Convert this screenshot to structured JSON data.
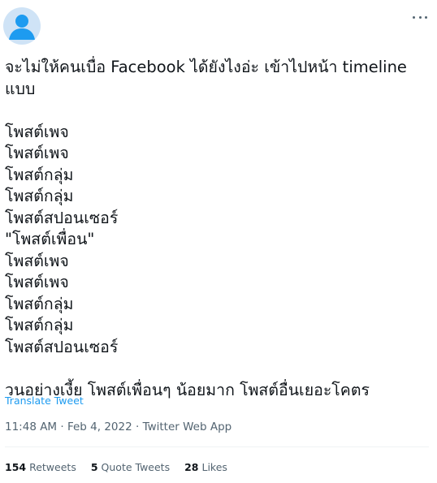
{
  "tweet": {
    "text": "จะไม่ให้คนเบื่อ Facebook ได้ยังไงอ่ะ เข้าไปหน้า timeline\nแบบ\n\nโพสต์เพจ\nโพสต์เพจ\nโพสต์กลุ่ม\nโพสต์กลุ่ม\nโพสต์สปอนเซอร์\n\"โพสต์เพื่อน\"\nโพสต์เพจ\nโพสต์เพจ\nโพสต์กลุ่ม\nโพสต์กลุ่ม\nโพสต์สปอนเซอร์\n\nวนอย่างเงี้ย โพสต์เพื่อนๆ น้อยมาก โพสต์อื่นเยอะโคตร",
    "translate_label": "Translate Tweet",
    "time": "11:48 AM",
    "separator": " · ",
    "date": "Feb 4, 2022",
    "source": "Twitter Web App"
  },
  "stats": {
    "retweets_count": "154",
    "retweets_label": "Retweets",
    "quotes_count": "5",
    "quotes_label": "Quote Tweets",
    "likes_count": "28",
    "likes_label": "Likes"
  },
  "icons": {
    "avatar": "default-user-avatar-icon",
    "more": "more-options-icon"
  },
  "colors": {
    "text": "#0f1419",
    "secondary": "#536471",
    "link": "#1d9bf0",
    "avatar_bg": "#cfe3f6",
    "avatar_fg": "#1d9bf0"
  }
}
